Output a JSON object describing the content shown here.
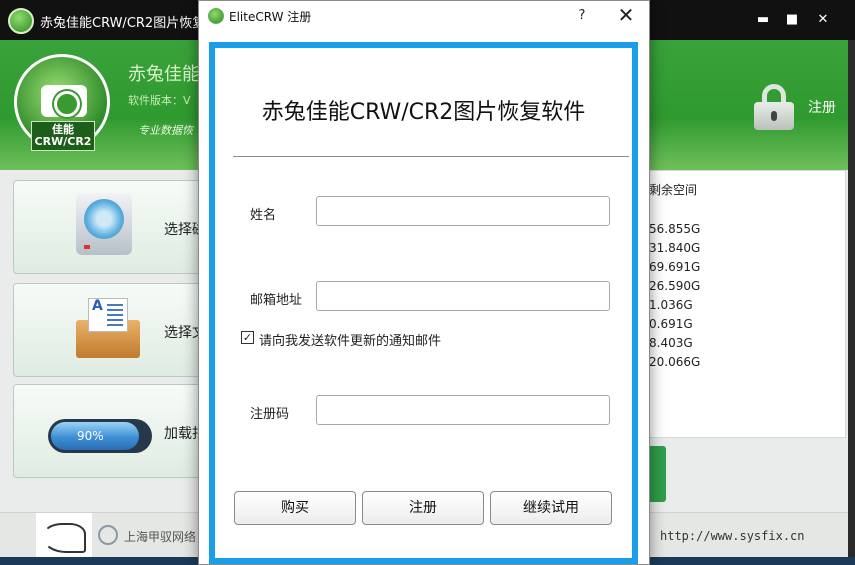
{
  "main_window": {
    "title": "赤兔佳能CRW/CR2图片恢复软",
    "controls": {
      "minimize": "▬",
      "maximize": "■",
      "close": "✕"
    },
    "header": {
      "app_name": "赤兔佳能",
      "version": "软件版本：V",
      "slogan": "专业数据恢",
      "badge_line1": "佳能",
      "badge_line2": "CRW/CR2",
      "register_label": "注册"
    },
    "tiles": [
      {
        "label": "选择磁",
        "icon": "hard-drive-icon"
      },
      {
        "label": "选择文",
        "icon": "folder-document-icon"
      },
      {
        "label": "加载扫",
        "icon": "progress-icon",
        "progress_text": "90%",
        "progress": 0.9
      }
    ],
    "drive_panel": {
      "column_header": "剩余空间",
      "free_space": [
        "56.855G",
        "31.840G",
        "69.691G",
        "26.590G",
        "1.036G",
        "0.691G",
        "8.403G",
        "20.066G"
      ]
    },
    "footer": {
      "company": "上海甲驭网络",
      "url": "http://www.sysfix.cn"
    }
  },
  "dialog": {
    "title": "EliteCRW 注册",
    "help_label": "?",
    "close_label": "✕",
    "heading": "赤兔佳能CRW/CR2图片恢复软件",
    "fields": {
      "name_label": "姓名",
      "name_value": "",
      "email_label": "邮箱地址",
      "email_value": "",
      "code_label": "注册码",
      "code_value": ""
    },
    "notify": {
      "checked": true,
      "check_mark": "✓",
      "label": "请向我发送软件更新的通知邮件"
    },
    "buttons": {
      "buy": "购买",
      "register": "注册",
      "trial": "继续试用"
    }
  },
  "colors": {
    "accent_blue": "#1a9ee8",
    "header_green": "#3aa23a",
    "titlebar": "#111111"
  }
}
